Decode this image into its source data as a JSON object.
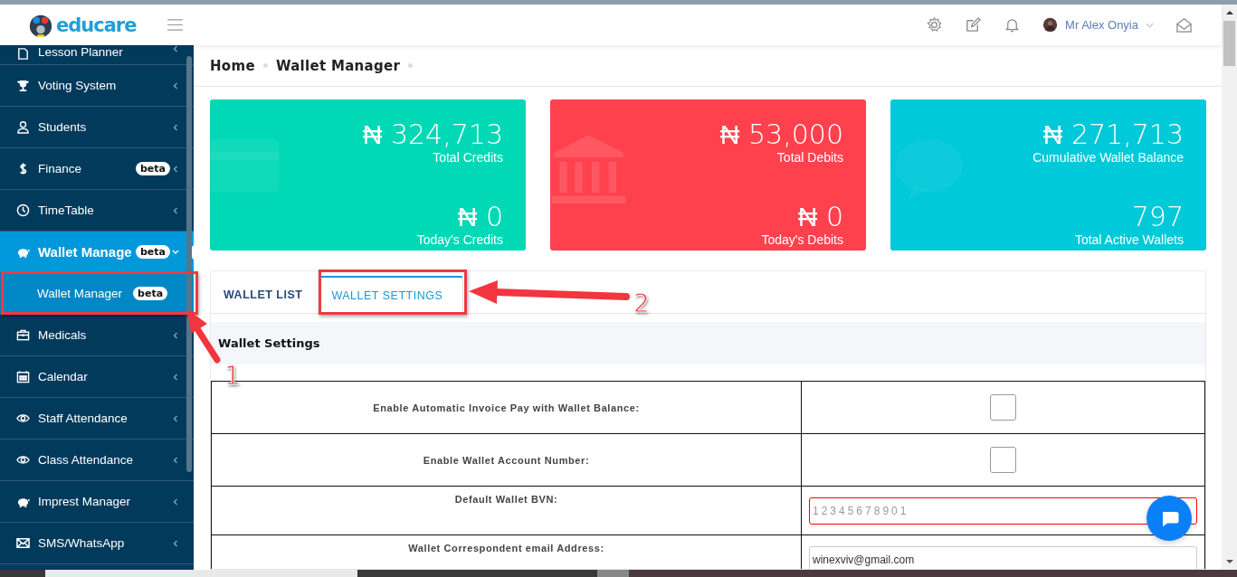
{
  "header": {
    "brand": "educare",
    "user_name": "Mr Alex Onyia"
  },
  "sidebar": {
    "items": [
      {
        "label": "Lesson Planner",
        "selected": false,
        "expanded": false
      },
      {
        "label": "Voting System",
        "selected": false,
        "expanded": false
      },
      {
        "label": "Students",
        "selected": false,
        "expanded": false
      },
      {
        "label": "Finance",
        "badge": "beta",
        "selected": false,
        "expanded": false
      },
      {
        "label": "TimeTable",
        "selected": false,
        "expanded": false
      },
      {
        "label": "Wallet Manage",
        "badge": "beta",
        "selected": true,
        "expanded": true,
        "children": [
          {
            "label": "Wallet Manager",
            "badge": "beta",
            "selected": true
          }
        ]
      },
      {
        "label": "Medicals",
        "selected": false,
        "expanded": false
      },
      {
        "label": "Calendar",
        "selected": false,
        "expanded": false
      },
      {
        "label": "Staff Attendance",
        "selected": false,
        "expanded": false
      },
      {
        "label": "Class Attendance",
        "selected": false,
        "expanded": false
      },
      {
        "label": "Imprest Manager",
        "selected": false,
        "expanded": false
      },
      {
        "label": "SMS/WhatsApp",
        "selected": false,
        "expanded": false
      }
    ]
  },
  "breadcrumb": [
    "Home",
    "Wallet Manager"
  ],
  "stat_cards": [
    {
      "color": "#00d8b6",
      "value": "₦ 324,713",
      "label": "Total Credits",
      "value_2": "₦ 0",
      "label_2": "Today's Credits"
    },
    {
      "color": "#ff414d",
      "value": "₦ 53,000",
      "label": "Total Debits",
      "value_2": "₦ 0",
      "label_2": "Today's Debits"
    },
    {
      "color": "#00c9d9",
      "value": "₦ 271,713",
      "label": "Cumulative Wallet Balance",
      "value_2": "797",
      "label_2": "Total Active Wallets"
    }
  ],
  "tabs": [
    {
      "label": "WALLET LIST",
      "selected": false
    },
    {
      "label": "WALLET SETTINGS",
      "selected": true
    }
  ],
  "section_title": "Wallet Settings",
  "settings_rows": [
    {
      "kind": "checkbox",
      "label": "Enable Automatic Invoice Pay with Wallet Balance:",
      "checked": false
    },
    {
      "kind": "checkbox",
      "label": "Enable Wallet Account Number:",
      "checked": false
    },
    {
      "kind": "input",
      "label": "Default Wallet BVN:",
      "placeholder": "12345678901",
      "invalid": true
    },
    {
      "kind": "input",
      "label": "Wallet Correspondent email Address:",
      "value": "winexviv@gmail.com",
      "invalid": false
    }
  ],
  "callouts": [
    "1",
    "2"
  ]
}
